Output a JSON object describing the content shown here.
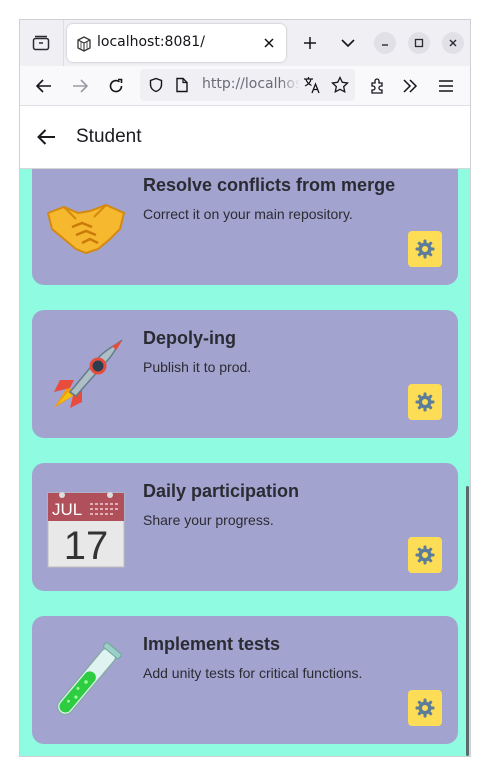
{
  "browser": {
    "tab": {
      "title": "localhost:8081/"
    },
    "url": "http://localhost:8081/"
  },
  "app": {
    "title": "Student",
    "cards": [
      {
        "title": "Resolve conflicts from merge",
        "description": "Correct it on your main repository.",
        "icon": "handshake-icon"
      },
      {
        "title": "Depoly-ing",
        "description": "Publish it to prod.",
        "icon": "rocket-icon"
      },
      {
        "title": "Daily participation",
        "description": "Share your progress.",
        "icon": "calendar-icon",
        "calendar_month": "JUL",
        "calendar_day": "17"
      },
      {
        "title": "Implement tests",
        "description": "Add unity tests for critical functions.",
        "icon": "test-tube-icon"
      }
    ]
  },
  "colors": {
    "app_background": "#8ffbe0",
    "card": "#a3a3cf",
    "settings_button": "#fddc56"
  }
}
